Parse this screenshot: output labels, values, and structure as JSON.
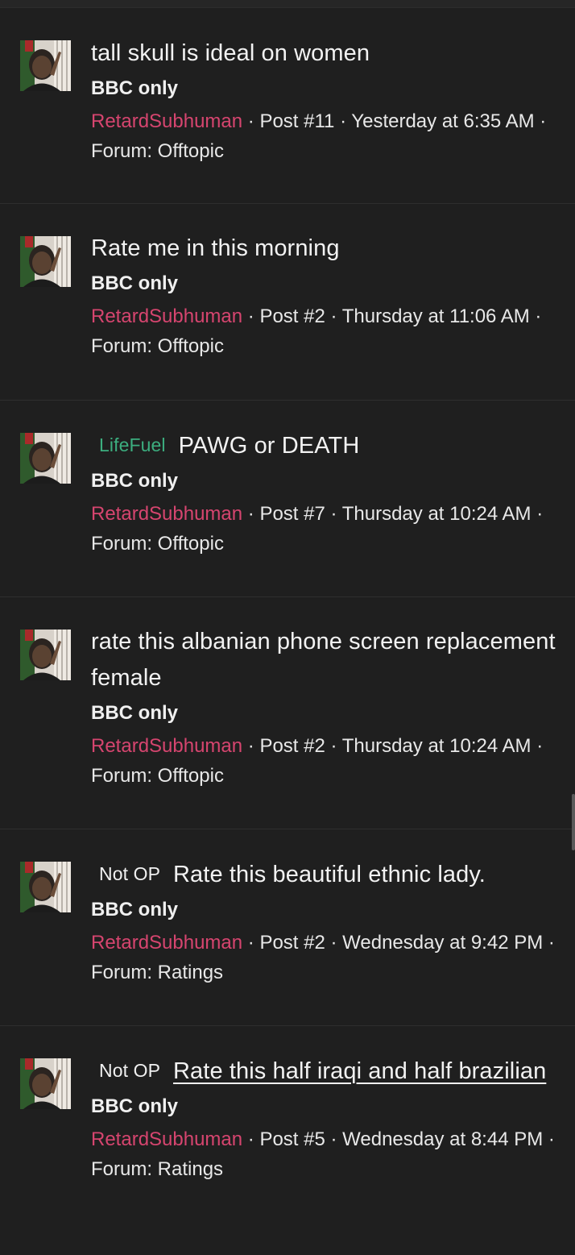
{
  "results": [
    {
      "prefix": "",
      "title": "tall skull is ideal on women",
      "snippet": "BBC only",
      "user": "RetardSubhuman",
      "meta": " · Post #11 · Yesterday at 6:35 AM · Forum: Offtopic"
    },
    {
      "prefix": "",
      "title": "Rate me in this morning",
      "snippet": "BBC only",
      "user": "RetardSubhuman",
      "meta": " · Post #2 · Thursday at 11:06 AM · Forum: Offtopic"
    },
    {
      "prefix": "LifeFuel",
      "title": "PAWG or DEATH",
      "snippet": "BBC only",
      "user": "RetardSubhuman",
      "meta": " · Post #7 · Thursday at 10:24 AM · Forum: Offtopic"
    },
    {
      "prefix": "",
      "title": "rate this albanian phone screen replacement female",
      "snippet": "BBC only",
      "user": "RetardSubhuman",
      "meta": " · Post #2 · Thursday at 10:24 AM · Forum: Offtopic"
    },
    {
      "prefix": "Not OP",
      "title": "Rate this beautiful ethnic lady.",
      "snippet": "BBC only",
      "user": "RetardSubhuman",
      "meta": " · Post #2 · Wednesday at 9:42 PM · Forum: Ratings"
    },
    {
      "prefix": "Not OP",
      "title": "Rate this half iraqi and half brazilian",
      "snippet": "BBC only",
      "user": "RetardSubhuman",
      "meta": " · Post #5 · Wednesday at 8:44 PM · Forum: Ratings"
    }
  ],
  "colors": {
    "background": "#1f1f1f",
    "username": "#d6456f",
    "lifefuel_prefix": "#3cae7f"
  },
  "icons": {
    "avatar": "user-avatar-photo"
  }
}
